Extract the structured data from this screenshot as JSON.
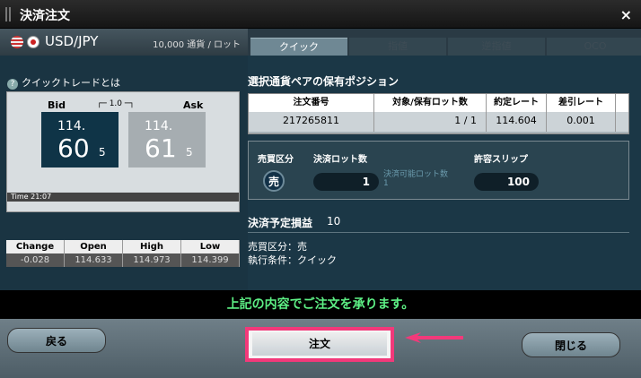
{
  "window": {
    "title": "決済注文",
    "close": "×"
  },
  "pair": {
    "name": "USD/JPY",
    "lot_unit": "10,000 通貨 / ロット"
  },
  "tabs": [
    {
      "label": "クイック"
    },
    {
      "label": "指値"
    },
    {
      "label": "逆指値"
    },
    {
      "label": "OCO"
    }
  ],
  "quick": {
    "link": "クイックトレードとは"
  },
  "board": {
    "bid_label": "Bid",
    "ask_label": "Ask",
    "spread": "1.0",
    "bid": {
      "big": "114.",
      "main": "60",
      "sub": "5"
    },
    "ask": {
      "big": "114.",
      "main": "61",
      "sub": "5"
    },
    "time_label": "Time",
    "time": "21:07"
  },
  "quote": {
    "headers": [
      "Change",
      "Open",
      "High",
      "Low"
    ],
    "values": [
      "-0.028",
      "114.633",
      "114.973",
      "114.399"
    ]
  },
  "position": {
    "title": "選択通貨ペアの保有ポジション",
    "headers": [
      "注文番号",
      "対象/保有ロット数",
      "約定レート",
      "差引レート"
    ],
    "row": [
      "217265811",
      "1 / 1",
      "114.604",
      "0.001"
    ]
  },
  "settlement": {
    "side_label": "売買区分",
    "side": "売",
    "lot_label": "決済ロット数",
    "lot": "1",
    "available_label": "決済可能ロット数",
    "available": "1",
    "slip_label": "許容スリップ",
    "slip": "100"
  },
  "profit": {
    "label": "決済予定損益",
    "value": "10"
  },
  "summary": {
    "side": "売買区分：売",
    "exec": "執行条件：クイック"
  },
  "confirm": "上記の内容でご注文を承ります。",
  "buttons": {
    "back": "戻る",
    "order": "注文",
    "close": "閉じる"
  }
}
